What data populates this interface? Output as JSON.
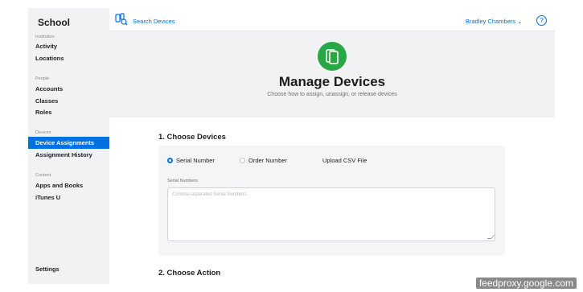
{
  "sidebar": {
    "brand": "School",
    "sections": [
      {
        "title": "Institution",
        "items": [
          "Activity",
          "Locations"
        ]
      },
      {
        "title": "People",
        "items": [
          "Accounts",
          "Classes",
          "Roles"
        ]
      },
      {
        "title": "Devices",
        "items": [
          "Device Assignments",
          "Assignment History"
        ]
      },
      {
        "title": "Content",
        "items": [
          "Apps and Books",
          "iTunes U"
        ]
      }
    ],
    "settings": "Settings"
  },
  "topbar": {
    "search_label": "Search Devices",
    "user_name": "Bradley Chambers",
    "user_chevron": "⌄",
    "help": "?"
  },
  "hero": {
    "title": "Manage Devices",
    "subtitle": "Choose how to assign, unassign, or release devices"
  },
  "step1": {
    "title": "1. Choose Devices",
    "options": [
      "Serial Number",
      "Order Number",
      "Upload CSV File"
    ],
    "selected": "Serial Number",
    "field_label": "Serial Numbers",
    "placeholder": "Comma-separated Serial Numbers"
  },
  "step2": {
    "title": "2. Choose Action"
  },
  "watermark": "feedproxy.google.com",
  "colors": {
    "accent": "#0071e3",
    "hero_icon": "#28a745"
  }
}
